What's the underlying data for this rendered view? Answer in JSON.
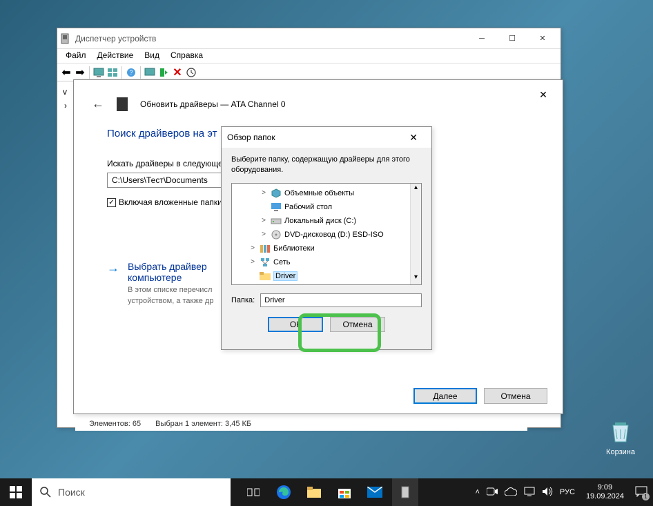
{
  "device_manager": {
    "title": "Диспетчер устройств",
    "menu": {
      "file": "Файл",
      "action": "Действие",
      "view": "Вид",
      "help": "Справка"
    },
    "tree_root_marker": "v"
  },
  "wizard": {
    "title": "Обновить драйверы — ATA Channel 0",
    "heading": "Поиск драйверов на эт",
    "search_label": "Искать драйверы в следующе",
    "path_value": "C:\\Users\\Тест\\Documents",
    "checkbox_label": "Включая вложенные папки",
    "option_title_line1": "Выбрать драйвер",
    "option_title_line2": "компьютере",
    "option_desc_line1": "В этом списке перечисл",
    "option_desc_line2": "устройством, а также др",
    "btn_next": "Далее",
    "btn_cancel": "Отмена"
  },
  "dialog": {
    "title": "Обзор папок",
    "message": "Выберите папку, содержащую драйверы для этого оборудования.",
    "tree": [
      {
        "label": "Объемные объекты",
        "indent": 2,
        "toggle": ">",
        "icon": "cube"
      },
      {
        "label": "Рабочий стол",
        "indent": 2,
        "toggle": "",
        "icon": "desktop"
      },
      {
        "label": "Локальный диск (C:)",
        "indent": 2,
        "toggle": ">",
        "icon": "drive"
      },
      {
        "label": "DVD-дисковод (D:) ESD-ISO",
        "indent": 2,
        "toggle": ">",
        "icon": "dvd"
      },
      {
        "label": "Библиотеки",
        "indent": 1,
        "toggle": ">",
        "icon": "libraries"
      },
      {
        "label": "Сеть",
        "indent": 1,
        "toggle": ">",
        "icon": "network"
      },
      {
        "label": "Driver",
        "indent": 1,
        "toggle": "",
        "icon": "folder",
        "selected": true
      }
    ],
    "folder_label": "Папка:",
    "folder_value": "Driver",
    "btn_ok": "ОК",
    "btn_cancel": "Отмена"
  },
  "explorer_status": {
    "elements": "Элементов: 65",
    "selection": "Выбран 1 элемент: 3,45 КБ"
  },
  "desktop": {
    "recycle_bin": "Корзина"
  },
  "taskbar": {
    "search_placeholder": "Поиск",
    "lang": "РУС",
    "time": "9:09",
    "date": "19.09.2024",
    "notif_count": "1"
  }
}
